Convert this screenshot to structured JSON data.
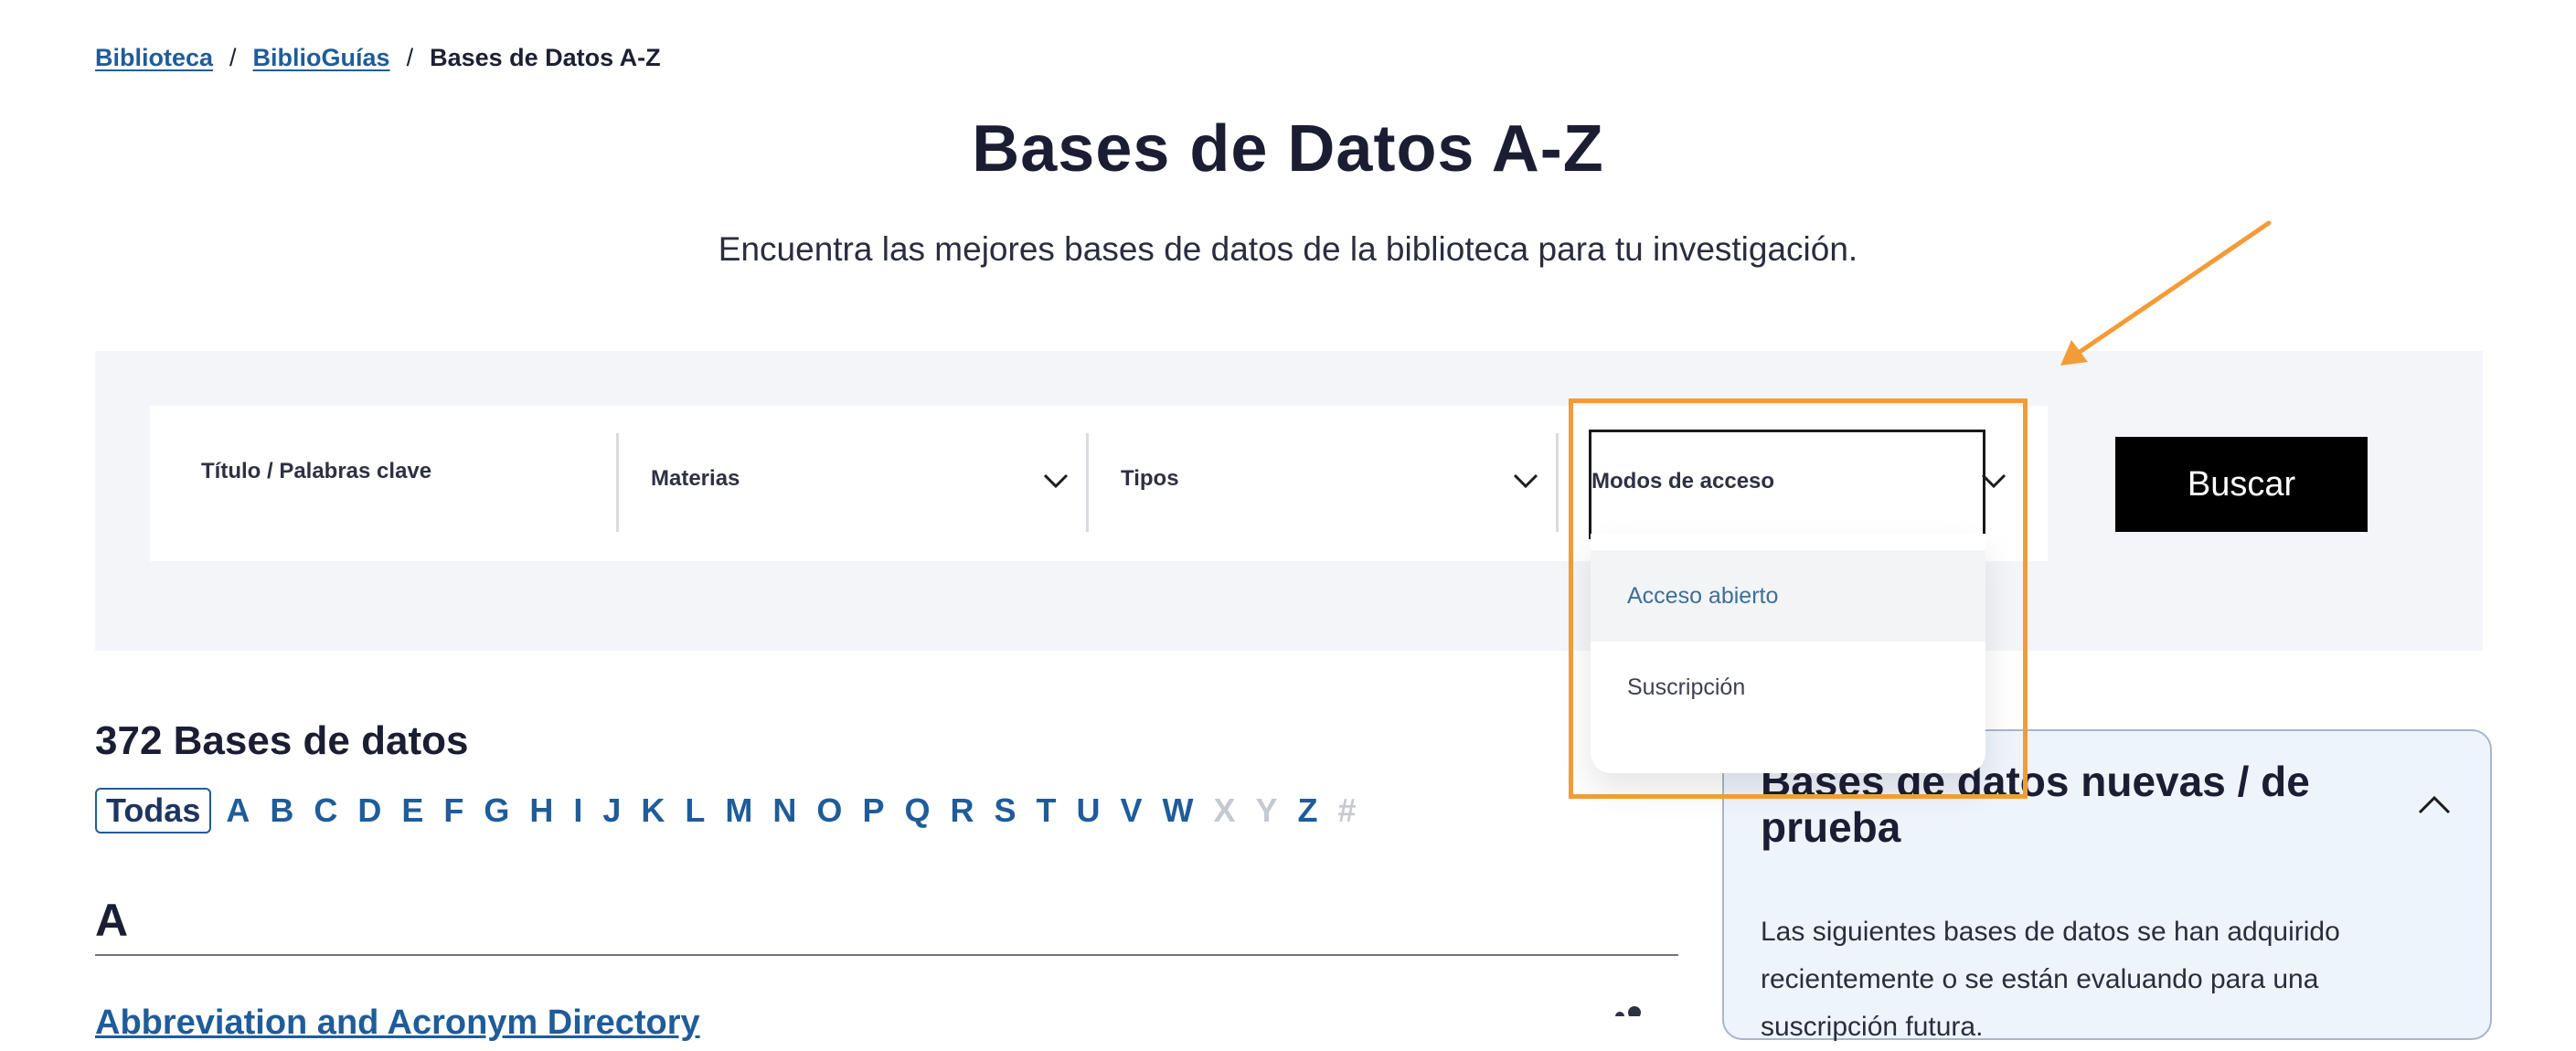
{
  "breadcrumb": {
    "items": [
      {
        "label": "Biblioteca",
        "link": true
      },
      {
        "label": "BiblioGuías",
        "link": true
      },
      {
        "label": "Bases de Datos A-Z",
        "link": false
      }
    ],
    "separator": "/"
  },
  "page": {
    "title": "Bases de Datos A-Z",
    "subtitle": "Encuentra las mejores bases de datos de la biblioteca para tu investigación."
  },
  "search": {
    "keyword_label": "Título / Palabras clave",
    "subjects_label": "Materias",
    "types_label": "Tipos",
    "access_label": "Modos de acceso",
    "button_label": "Buscar",
    "access_options": [
      "Acceso abierto",
      "Suscripción"
    ],
    "highlighted_option_index": 0
  },
  "results": {
    "count_label": "372 Bases de datos",
    "alphabet": [
      {
        "label": "Todas",
        "state": "active"
      },
      {
        "label": "A",
        "state": "enabled"
      },
      {
        "label": "B",
        "state": "enabled"
      },
      {
        "label": "C",
        "state": "enabled"
      },
      {
        "label": "D",
        "state": "enabled"
      },
      {
        "label": "E",
        "state": "enabled"
      },
      {
        "label": "F",
        "state": "enabled"
      },
      {
        "label": "G",
        "state": "enabled"
      },
      {
        "label": "H",
        "state": "enabled"
      },
      {
        "label": "I",
        "state": "enabled"
      },
      {
        "label": "J",
        "state": "enabled"
      },
      {
        "label": "K",
        "state": "enabled"
      },
      {
        "label": "L",
        "state": "enabled"
      },
      {
        "label": "M",
        "state": "enabled"
      },
      {
        "label": "N",
        "state": "enabled"
      },
      {
        "label": "O",
        "state": "enabled"
      },
      {
        "label": "P",
        "state": "enabled"
      },
      {
        "label": "Q",
        "state": "enabled"
      },
      {
        "label": "R",
        "state": "enabled"
      },
      {
        "label": "S",
        "state": "enabled"
      },
      {
        "label": "T",
        "state": "enabled"
      },
      {
        "label": "U",
        "state": "enabled"
      },
      {
        "label": "V",
        "state": "enabled"
      },
      {
        "label": "W",
        "state": "enabled"
      },
      {
        "label": "X",
        "state": "disabled"
      },
      {
        "label": "Y",
        "state": "disabled"
      },
      {
        "label": "Z",
        "state": "enabled"
      },
      {
        "label": "#",
        "state": "disabled"
      }
    ],
    "section_letter": "A",
    "first_item": "Abbreviation and Acronym Directory"
  },
  "new_databases": {
    "title": "Bases de datos nuevas / de prueba",
    "description": "Las siguientes bases de datos se han adquirido recientemente o se están evaluando para una suscripción futura."
  },
  "icons": {
    "dropdown": "chevron-down-icon",
    "collapse": "chevron-up-icon",
    "share": "share-icon"
  },
  "colors": {
    "link": "#1f5c99",
    "annotation": "#f39c37",
    "panel_bg": "#f4f5f8",
    "card_bg": "#eef4fb",
    "button_bg": "#000000"
  }
}
